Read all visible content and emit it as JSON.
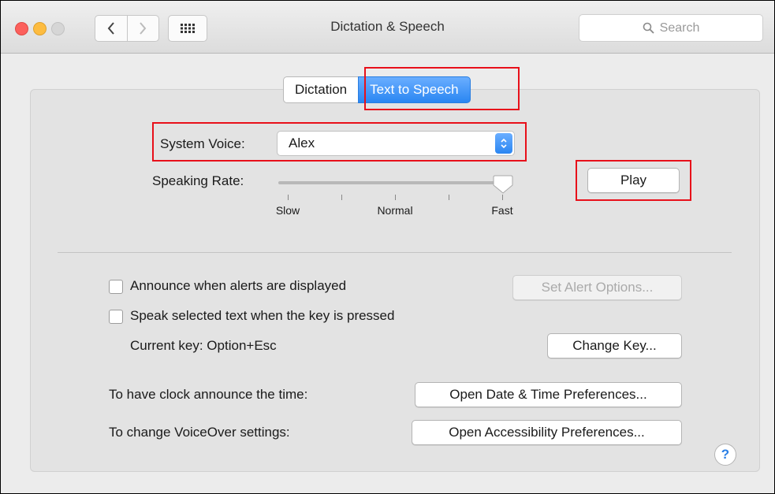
{
  "window": {
    "title": "Dictation & Speech"
  },
  "search": {
    "placeholder": "Search"
  },
  "tabs": [
    {
      "label": "Dictation",
      "selected": false
    },
    {
      "label": "Text to Speech",
      "selected": true
    }
  ],
  "system_voice": {
    "label": "System Voice:",
    "value": "Alex"
  },
  "speaking_rate": {
    "label": "Speaking Rate:",
    "ticks": [
      "Slow",
      "Normal",
      "Fast"
    ],
    "value_fraction": 0.98
  },
  "play_button": "Play",
  "announce_alerts": {
    "label": "Announce when alerts are displayed",
    "checked": false,
    "button": "Set Alert Options..."
  },
  "speak_selected": {
    "label": "Speak selected text when the key is pressed",
    "checked": false
  },
  "current_key": {
    "label": "Current key: Option+Esc",
    "button": "Change Key..."
  },
  "clock": {
    "label": "To have clock announce the time:",
    "button": "Open Date & Time Preferences..."
  },
  "voiceover": {
    "label": "To change VoiceOver settings:",
    "button": "Open Accessibility Preferences..."
  },
  "help": "?",
  "colors": {
    "accent": "#2a86f2",
    "highlight_box": "#e8101a"
  }
}
